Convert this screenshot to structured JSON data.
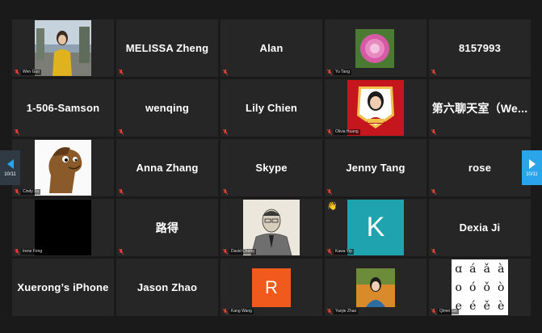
{
  "gallery": {
    "tiles": [
      {
        "big": "",
        "small": "Wen Guo"
      },
      {
        "big": "MELISSA Zheng",
        "small": ""
      },
      {
        "big": "Alan",
        "small": ""
      },
      {
        "big": "",
        "small": "Yu Tang"
      },
      {
        "big": "8157993",
        "small": ""
      },
      {
        "big": "1-506-Samson",
        "small": ""
      },
      {
        "big": "wenqing",
        "small": ""
      },
      {
        "big": "Lily Chien",
        "small": ""
      },
      {
        "big": "",
        "small": "Olivia Huang"
      },
      {
        "big": "第六聊天室（We...",
        "small": ""
      },
      {
        "big": "",
        "small": "Cindy Xu"
      },
      {
        "big": "Anna Zhang",
        "small": ""
      },
      {
        "big": "Skype",
        "small": ""
      },
      {
        "big": "Jenny Tang",
        "small": ""
      },
      {
        "big": "rose",
        "small": ""
      },
      {
        "big": "",
        "small": "Irene Feng"
      },
      {
        "big": "路得",
        "small": ""
      },
      {
        "big": "",
        "small": "David Cheng"
      },
      {
        "big": "K",
        "small": "Kawa Yip"
      },
      {
        "big": "Dexia Ji",
        "small": ""
      },
      {
        "big": "Xuerong’s iPhone",
        "small": ""
      },
      {
        "big": "Jason Zhao",
        "small": ""
      },
      {
        "big": "R",
        "small": "Kang Wang"
      },
      {
        "big": "",
        "small": "Yanjie Zhao"
      },
      {
        "big": "",
        "small": "Qimei Sai"
      }
    ]
  },
  "nav": {
    "left_page": "10/11",
    "right_page": "10/11"
  },
  "letters": [
    "ɑ",
    "á",
    "ǎ",
    "à",
    "o",
    "ó",
    "ǒ",
    "ò",
    "e",
    "é",
    "ě",
    "è"
  ],
  "colors": {
    "mute": "#e0413a",
    "avatar_k": "#1fa3ae",
    "avatar_r": "#f05a1c",
    "nav_right": "#2aa4ea"
  }
}
